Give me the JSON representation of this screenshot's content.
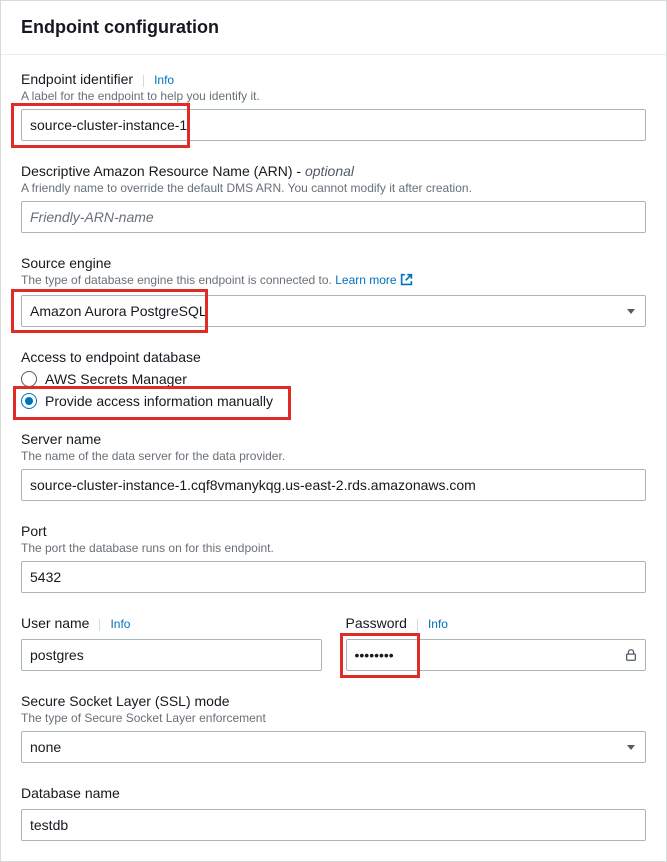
{
  "header": {
    "title": "Endpoint configuration"
  },
  "identifier": {
    "label": "Endpoint identifier",
    "info": "Info",
    "hint": "A label for the endpoint to help you identify it.",
    "value": "source-cluster-instance-1"
  },
  "arn": {
    "label": "Descriptive Amazon Resource Name (ARN) - ",
    "optional": "optional",
    "hint": "A friendly name to override the default DMS ARN. You cannot modify it after creation.",
    "placeholder": "Friendly-ARN-name"
  },
  "engine": {
    "label": "Source engine",
    "hint": "The type of database engine this endpoint is connected to.",
    "learn": "Learn more",
    "value": "Amazon Aurora PostgreSQL"
  },
  "access": {
    "label": "Access to endpoint database",
    "opt1": "AWS Secrets Manager",
    "opt2": "Provide access information manually"
  },
  "server": {
    "label": "Server name",
    "hint": "The name of the data server for the data provider.",
    "value": "source-cluster-instance-1.cqf8vmanykqg.us-east-2.rds.amazonaws.com"
  },
  "port": {
    "label": "Port",
    "hint": "The port the database runs on for this endpoint.",
    "value": "5432"
  },
  "user": {
    "label": "User name",
    "info": "Info",
    "value": "postgres"
  },
  "password": {
    "label": "Password",
    "info": "Info",
    "value": "••••••••"
  },
  "ssl": {
    "label": "Secure Socket Layer (SSL) mode",
    "hint": "The type of Secure Socket Layer enforcement",
    "value": "none"
  },
  "dbname": {
    "label": "Database name",
    "value": "testdb"
  }
}
